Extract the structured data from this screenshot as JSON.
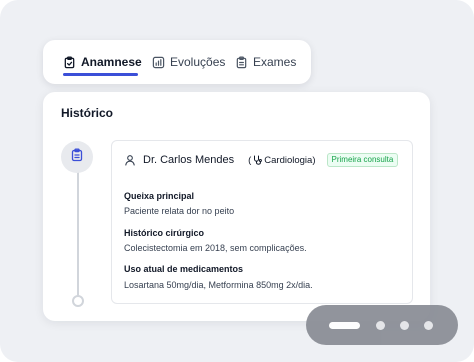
{
  "tabs": [
    {
      "label": "Anamnese",
      "icon": "clipboard-check-icon",
      "active": true
    },
    {
      "label": "Evoluções",
      "icon": "chart-icon",
      "active": false
    },
    {
      "label": "Exames",
      "icon": "clipboard-list-icon",
      "active": false
    }
  ],
  "history": {
    "title": "Histórico",
    "entry": {
      "doctor": "Dr. Carlos Mendes",
      "specialty_open": "(",
      "specialty": "Cardiologia)",
      "badge": "Primeira consulta",
      "fields": [
        {
          "label": "Queixa principal",
          "value": "Paciente relata dor no peito"
        },
        {
          "label": "Histórico cirúrgico",
          "value": "Colecistectomia em 2018, sem complicações."
        },
        {
          "label": "Uso atual de medicamentos",
          "value": "Losartana 50mg/dia, Metformina 850mg 2x/dia."
        }
      ]
    }
  },
  "pager": {
    "pages": 4,
    "current": 1
  },
  "colors": {
    "accent": "#3b4fd8",
    "badge_green": "#16a34a"
  }
}
